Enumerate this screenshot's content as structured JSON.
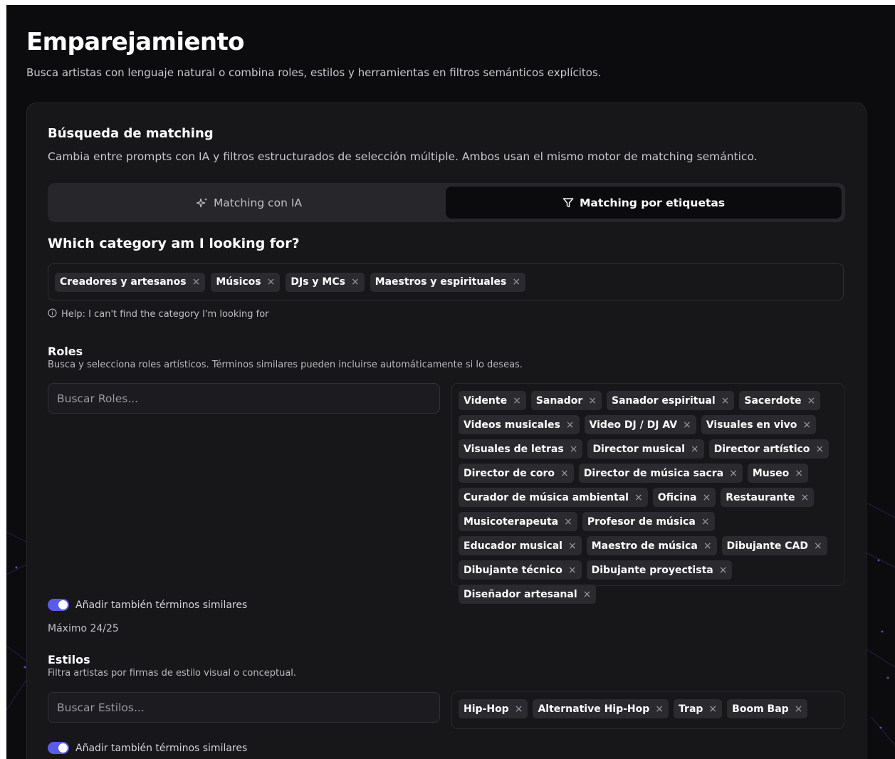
{
  "page": {
    "title": "Emparejamiento",
    "subtitle": "Busca artistas con lenguaje natural o combina roles, estilos y herramientas en filtros semánticos explícitos."
  },
  "card": {
    "title": "Búsqueda de matching",
    "description": "Cambia entre prompts con IA y filtros estructurados de selección múltiple. Ambos usan el mismo motor de matching semántico."
  },
  "mode_tabs": [
    {
      "label": "Matching con IA",
      "icon": "sparkles-icon",
      "active": false
    },
    {
      "label": "Matching por etiquetas",
      "icon": "filter-icon",
      "active": true
    }
  ],
  "category": {
    "heading": "Which category am I looking for?",
    "chips": [
      "Creadores y artesanos",
      "Músicos",
      "DJs y MCs",
      "Maestros y espirituales"
    ],
    "help": "Help: I can't find the category I'm looking for"
  },
  "roles": {
    "title": "Roles",
    "description": "Busca y selecciona roles artísticos. Términos similares pueden incluirse automáticamente si lo deseas.",
    "placeholder": "Buscar Roles...",
    "tags": [
      "Vidente",
      "Sanador",
      "Sanador espiritual",
      "Sacerdote",
      "Videos musicales",
      "Video DJ / DJ AV",
      "Visuales en vivo",
      "Visuales de letras",
      "Director musical",
      "Director artístico",
      "Director de coro",
      "Director de música sacra",
      "Museo",
      "Curador de música ambiental",
      "Oficina",
      "Restaurante",
      "Musicoterapeuta",
      "Profesor de música",
      "Educador musical",
      "Maestro de música",
      "Dibujante CAD",
      "Dibujante técnico",
      "Dibujante proyectista",
      "Diseñador artesanal"
    ],
    "similar_toggle": {
      "label": "Añadir también términos similares",
      "on": true
    },
    "max_label": "Máximo 24/25"
  },
  "styles": {
    "title": "Estilos",
    "description": "Filtra artistas por firmas de estilo visual o conceptual.",
    "placeholder": "Buscar Estilos...",
    "tags": [
      "Hip-Hop",
      "Alternative Hip-Hop",
      "Trap",
      "Boom Bap"
    ],
    "similar_toggle": {
      "label": "Añadir también términos similares",
      "on": true
    }
  },
  "colors": {
    "background": "#0c0c0e",
    "card": "#17171a",
    "chip": "#2a2a2f",
    "accent": "#5b5ce6"
  },
  "chip_remove_glyph": "×"
}
